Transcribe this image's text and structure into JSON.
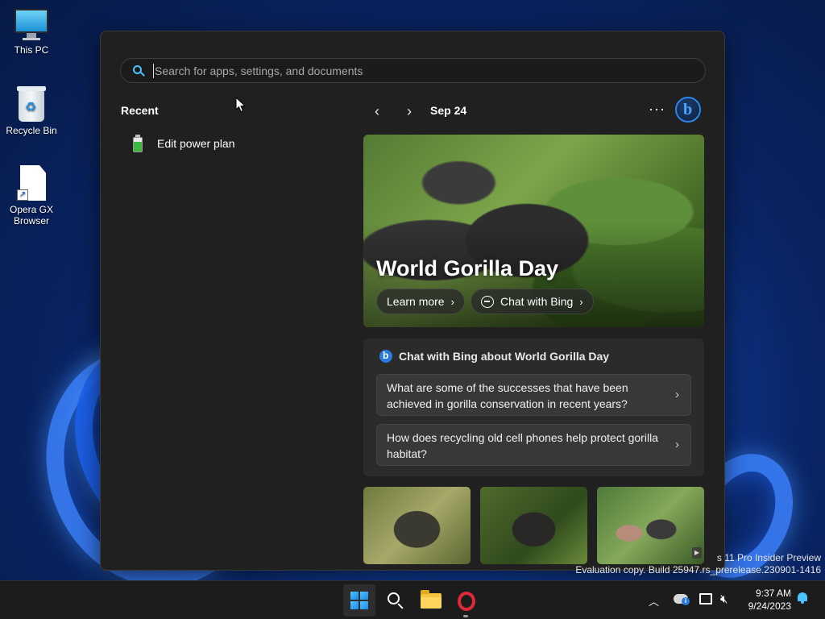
{
  "desktop": {
    "icons": [
      {
        "label": "This PC",
        "icon": "computer-icon"
      },
      {
        "label": "Recycle Bin",
        "icon": "recycle-bin-icon"
      },
      {
        "label": "Opera GX Browser",
        "icon": "shortcut-file-icon"
      }
    ],
    "watermark": {
      "line1": "s 11 Pro Insider Preview",
      "line2": "Evaluation copy. Build 25947.rs_prerelease.230901-1416"
    }
  },
  "start_menu": {
    "search": {
      "placeholder": "Search for apps, settings, and documents",
      "value": ""
    },
    "recent": {
      "title": "Recent",
      "items": [
        {
          "label": "Edit power plan",
          "icon": "battery-icon"
        }
      ]
    },
    "feed": {
      "date": "Sep 24",
      "more_label": "···",
      "hero": {
        "title": "World Gorilla Day",
        "learn_more": "Learn more",
        "chat_with_bing": "Chat with Bing"
      },
      "chat_card": {
        "title": "Chat with Bing about World Gorilla Day",
        "questions": [
          "What are some of the successes that have been achieved in gorilla conservation in recent years?",
          "How does recycling old cell phones help protect gorilla habitat?"
        ]
      }
    }
  },
  "taskbar": {
    "apps": [
      "start-button",
      "search-button",
      "file-explorer",
      "opera-gx"
    ],
    "clock": {
      "time": "9:37 AM",
      "date": "9/24/2023"
    }
  },
  "colors": {
    "accent": "#4cc2ff",
    "panel": "#202020",
    "card": "#2b2b2b",
    "opera": "#e02a3a"
  }
}
